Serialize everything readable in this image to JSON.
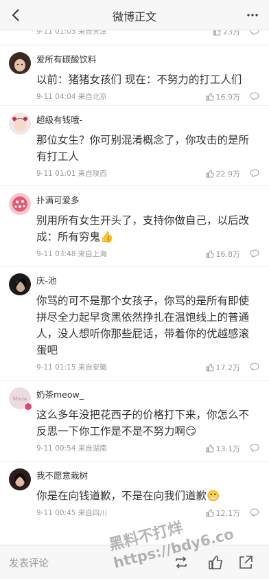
{
  "header": {
    "title": "微博正文",
    "back_icon": "chevron-left-icon",
    "more_icon": "ellipsis-icon"
  },
  "partial_comment": {
    "meta": "9-11 01:03 来自天津",
    "likes": "23万"
  },
  "comments": [
    {
      "name": "爱所有碳酸饮料",
      "text": "以前：猪猪女孩们 现在：不努力的打工人们",
      "meta": "9-11 04:04 来自北京",
      "likes": "16.9万"
    },
    {
      "name": "超级有钱哦-",
      "text": "那位女生？你可别混淆概念了，你攻击的是所有打工人",
      "meta": "9-11 01:01 来自陕西",
      "likes": "22.9万"
    },
    {
      "name": "扑满可爱多",
      "text": "别用所有女生开头了，支持你做自己，以后改成：所有穷鬼👍",
      "meta": "9-11 03:48 来自上海",
      "likes": "16.8万"
    },
    {
      "name": "庆-池",
      "text": "你骂的可不是那个女孩子，你骂的是所有即使拼尽全力起早贪黑依然挣扎在温饱线上的普通人，没人想听你那些屁话，带着你的优越感滚蛋吧",
      "meta": "9-11 01:15 来自安徽",
      "likes": "17.2万"
    },
    {
      "name": "奶茶meow_",
      "text": "这么多年没把花西子的价格打下来，你怎么不反思一下你工作是不是不努力啊😏",
      "meta": "9-11 00:54 来自湖南",
      "likes": "13.1万"
    },
    {
      "name": "我不愿意栽树",
      "text": "你是在向钱道歉，不是在向我们道歉😬",
      "meta": "9-11 00:45 来自四川",
      "likes": "12.1万"
    }
  ],
  "bottom": {
    "placeholder": "发表评论",
    "icons": [
      "repost-icon",
      "like-icon",
      "share-icon"
    ]
  },
  "watermark": {
    "line1": "黑料不打烊",
    "line2": "https://bdy6.co"
  }
}
